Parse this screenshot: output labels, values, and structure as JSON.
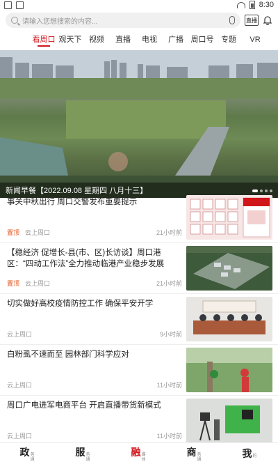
{
  "status": {
    "time": "8:30"
  },
  "search": {
    "placeholder": "请输入您想搜索的内容..."
  },
  "header": {
    "live_label": "直播"
  },
  "tabs": [
    "看周口",
    "观天下",
    "视频",
    "直播",
    "电视",
    "广播",
    "周口号",
    "专题",
    "VR"
  ],
  "active_tab_index": 0,
  "hero": {
    "caption": "新闻早餐【2022.09.08 星期四 八月十三】"
  },
  "feed": [
    {
      "title": "事关中秋出行 周口交警发布重要提示",
      "tag": "置顶",
      "source": "云上周口",
      "time": "21小时前"
    },
    {
      "title": "【稳经济 促增长-县(市、区)长访谈】周口港区：“四动工作法”全力推动临港产业稳步发展",
      "tag": "置顶",
      "source": "云上周口",
      "time": "21小时前"
    },
    {
      "title": "切实做好高校疫情防控工作 确保平安开学",
      "tag": "",
      "source": "云上周口",
      "time": "9小时前"
    },
    {
      "title": "白粉虱不速而至 园林部门科学应对",
      "tag": "",
      "source": "云上周口",
      "time": "11小时前"
    },
    {
      "title": "周口广电进军电商平台 开启直播带货新模式",
      "tag": "",
      "source": "云上周口",
      "time": "11小时前"
    }
  ],
  "bottom_nav": [
    {
      "label": "政",
      "sub": "务通"
    },
    {
      "label": "服",
      "sub": "务通"
    },
    {
      "label": "融",
      "sub": "媒体"
    },
    {
      "label": "商",
      "sub": "务通"
    },
    {
      "label": "我",
      "sub": "的"
    }
  ],
  "colors": {
    "accent": "#d0161b",
    "tag": "#e2531a"
  }
}
